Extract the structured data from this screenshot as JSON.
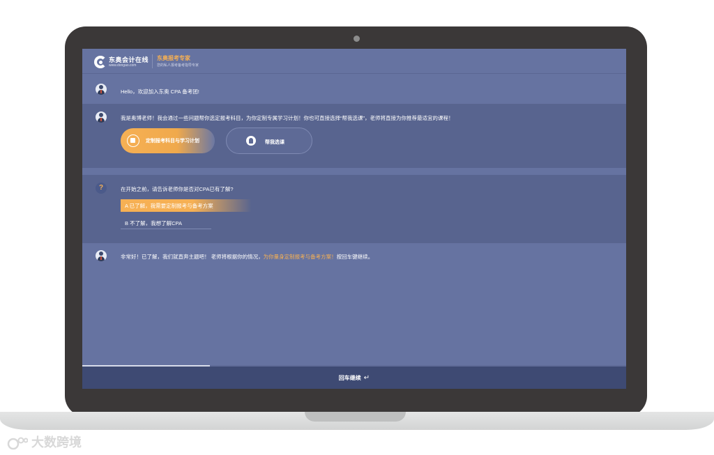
{
  "header": {
    "logo_text": "东奥会计在线",
    "logo_url": "www.dongao.com",
    "brand_title": "东奥报考专家",
    "brand_subtitle": "您的私人报考备考指导专家"
  },
  "messages": {
    "greeting": "Hello，欢迎加入东奥 CPA 备考团!",
    "intro": "我是奥博老师！我会通过一些问题帮你选定报考科目，为你定制专属学习计划！你也可直接选择“帮我选课”，老师将直接为你推荐最适宜的课程！",
    "question": "在开始之前，请告诉老师你是否对CPA已有了解?",
    "reply_prefix": "非常好！已了解，我们就直奔主题吧！ 老师将根据你的情况，",
    "reply_highlight": "为你量身定制报考与备考方案！",
    "reply_suffix": "按回车键继续。"
  },
  "actions": {
    "primary_label": "定制报考科目与学习计划",
    "secondary_label": "帮我选课"
  },
  "options": {
    "a": "A 已了解，我需要定制报考与备考方案",
    "b": "B 不了解，我想了解CPA"
  },
  "footer": {
    "continue_label": "回车继续",
    "enter_symbol": "↵",
    "progress_fraction": 0.235
  },
  "watermark": {
    "text": "大数跨境"
  },
  "colors": {
    "accent": "#f6b054",
    "screen_bg": "#6673a1",
    "panel_dark": "#58648f",
    "footer_bg": "#3e4a73",
    "laptop": "#3b3838"
  }
}
